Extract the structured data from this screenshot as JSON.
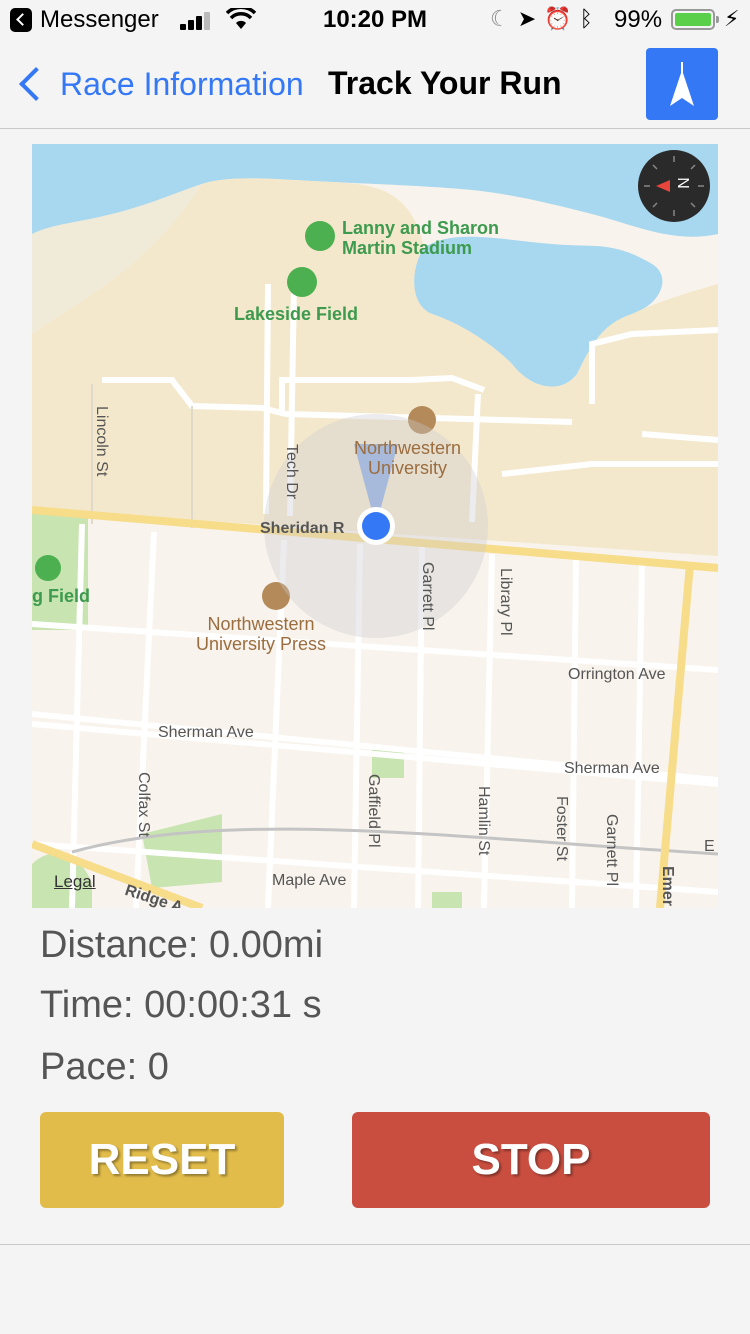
{
  "status_bar": {
    "app_name": "Messenger",
    "time": "10:20 PM",
    "battery_percent": "99%",
    "battery_level": 0.99
  },
  "nav": {
    "back_label": "Race Information",
    "title": "Track Your Run"
  },
  "map": {
    "labels": {
      "stadium": "Lanny and Sharon\nMartin Stadium",
      "lakeside": "Lakeside Field",
      "nu": "Northwestern\nUniversity",
      "nu_press": "Northwestern\nUniversity Press",
      "field_left": "g Field",
      "sheridan": "Sheridan R",
      "orrington": "Orrington Ave",
      "sherman1": "Sherman Ave",
      "sherman2": "Sherman Ave",
      "maple": "Maple Ave",
      "ridge": "Ridge A",
      "lincoln": "Lincoln St",
      "tech": "Tech Dr",
      "garrett": "Garrett Pl",
      "library": "Library Pl",
      "colfax": "Colfax St",
      "gaffield": "Gaffield Pl",
      "hamlin": "Hamlin St",
      "foster": "Foster St",
      "garnett": "Garnett Pl",
      "emerson": "Emer",
      "e_right": "E",
      "legal": "Legal",
      "compass_letter": "N"
    }
  },
  "stats": {
    "distance": "Distance:  0.00mi",
    "time": "Time: 00:00:31 s",
    "pace": "Pace: 0"
  },
  "buttons": {
    "reset": "RESET",
    "stop": "STOP"
  },
  "colors": {
    "accent_blue": "#3478f6",
    "reset_yellow": "#e1bc4a",
    "stop_red": "#c94e40",
    "water": "#a8d8ef",
    "campus": "#f4e8cc",
    "park": "#c8e4b0",
    "road_major": "#f7dc8a"
  }
}
